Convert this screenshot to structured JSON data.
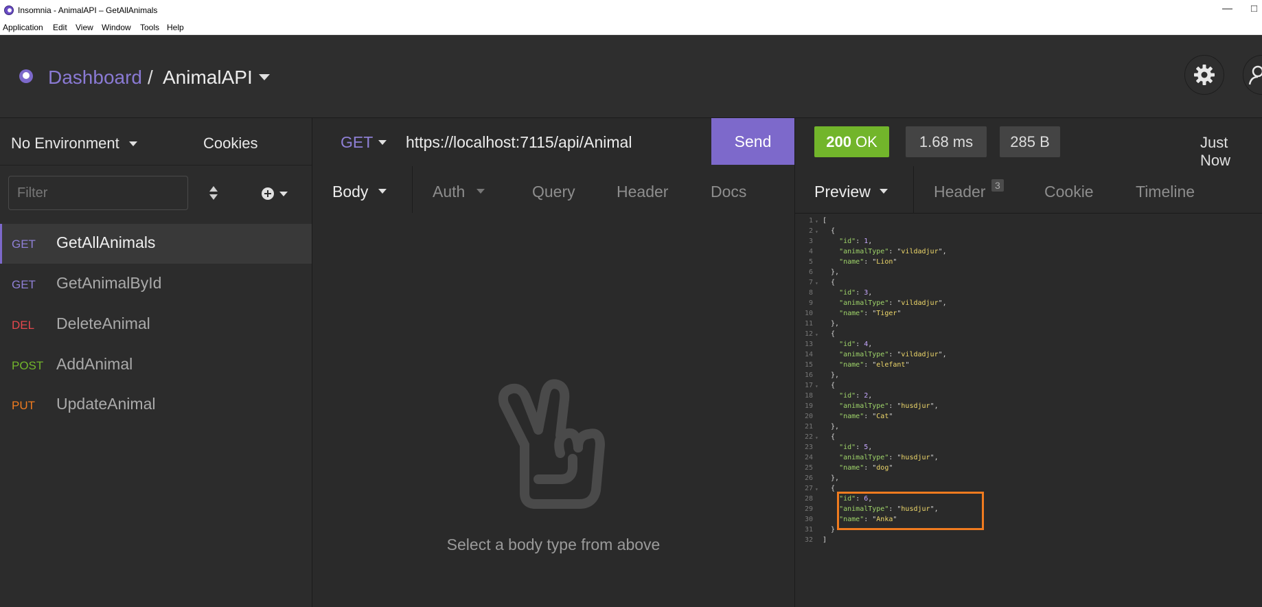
{
  "window": {
    "title": "Insomnia - AnimalAPI – GetAllAnimals"
  },
  "menu": [
    "Application",
    "Edit",
    "View",
    "Window",
    "Tools",
    "Help"
  ],
  "breadcrumb": {
    "dashboard": "Dashboard",
    "separator": "/",
    "project": "AnimalAPI"
  },
  "sidebar": {
    "environment": "No Environment",
    "cookies": "Cookies",
    "filter_placeholder": "Filter",
    "requests": [
      {
        "method": "GET",
        "name": "GetAllAnimals",
        "color": "#8f80d6",
        "active": true
      },
      {
        "method": "GET",
        "name": "GetAnimalById",
        "color": "#8f80d6",
        "active": false
      },
      {
        "method": "DEL",
        "name": "DeleteAnimal",
        "color": "#e5484d",
        "active": false
      },
      {
        "method": "POST",
        "name": "AddAnimal",
        "color": "#72b52b",
        "active": false
      },
      {
        "method": "PUT",
        "name": "UpdateAnimal",
        "color": "#f07b1f",
        "active": false
      }
    ]
  },
  "request": {
    "method": "GET",
    "url": "https://localhost:7115/api/Animal",
    "send_label": "Send",
    "tabs": [
      "Body",
      "Auth",
      "Query",
      "Header",
      "Docs"
    ],
    "empty_hint": "Select a body type from above"
  },
  "response": {
    "status_code": "200",
    "status_text": "OK",
    "time": "1.68 ms",
    "size": "285 B",
    "timestamp": "Just Now",
    "tabs": [
      "Preview",
      "Header",
      "Cookie",
      "Timeline"
    ],
    "header_count": "3",
    "items": [
      {
        "id": "1",
        "animalType": "vildadjur",
        "name": "Lion"
      },
      {
        "id": "3",
        "animalType": "vildadjur",
        "name": "Tiger"
      },
      {
        "id": "4",
        "animalType": "vildadjur",
        "name": "elefant"
      },
      {
        "id": "2",
        "animalType": "husdjur",
        "name": "Cat"
      },
      {
        "id": "5",
        "animalType": "husdjur",
        "name": "dog"
      },
      {
        "id": "6",
        "animalType": "husdjur",
        "name": "Anka"
      }
    ]
  },
  "colors": {
    "accent": "#7d69cb",
    "ok": "#72b52b",
    "highlight": "#f07b1f"
  }
}
